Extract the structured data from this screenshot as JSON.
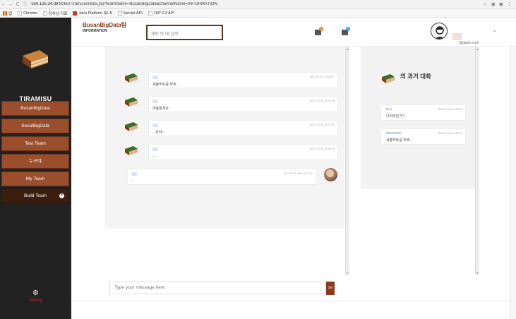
{
  "browser": {
    "url_host": "164.125.34.39",
    "url_rest": ":8060/Tiramisu/index.jsp?teamName=BusanBigData&channelName=INFORMATION",
    "bookmarks": [
      {
        "label": "앱"
      },
      {
        "label": "Chrome"
      },
      {
        "label": "강사님 자료"
      },
      {
        "label": "Java Platform SE 8"
      },
      {
        "label": "Servlet API"
      },
      {
        "label": "JSP 2.3 API"
      }
    ]
  },
  "sidebar": {
    "brand": "TIRAMISU",
    "items": [
      {
        "label": "BusanBigData"
      },
      {
        "label": "SeoulBigData"
      },
      {
        "label": "Test Team"
      },
      {
        "label": "누구야"
      },
      {
        "label": "My Team"
      },
      {
        "label": "Build Team"
      }
    ],
    "setting_label": "Setting"
  },
  "header": {
    "title": "BusanBigData팀",
    "subtitle": "INFORMATION",
    "search_placeholder": "채팅 방 내 검색",
    "email": "@daum.com",
    "notif_badge_1": "1",
    "notif_badge_2": "0"
  },
  "messages": [
    {
      "name": "...",
      "time": "2017-07-01 10:32:07",
      "text": "세슐히트를 하죠."
    },
    {
      "name": "...",
      "time": "2017-07-01 11:20:26",
      "text": "대동할게요"
    },
    {
      "name": "...",
      "time": "2017-07-01 11:27:07",
      "text": "...하하~"
    },
    {
      "name": "...",
      "time": "2017-07-01 11:28:19",
      "text": "..."
    },
    {
      "name": "...",
      "time": "2017-07-01 AM 11:47:07",
      "text": "..."
    }
  ],
  "past": {
    "title": "의 과거 대화",
    "items": [
      {
        "name": "DA)",
        "time": "2017-07-01 10:32:07",
        "text": "나자리인가?"
      },
      {
        "name": "RMATION)",
        "time": "2017-07-01 10:32:07",
        "text": "세슐히트를 하죠."
      }
    ]
  },
  "input": {
    "placeholder": "Type your message here",
    "send_label": "Se"
  },
  "colors": {
    "accent": "#8b3a1a",
    "sidebar": "#222222",
    "menu": "#9b4e2c"
  }
}
